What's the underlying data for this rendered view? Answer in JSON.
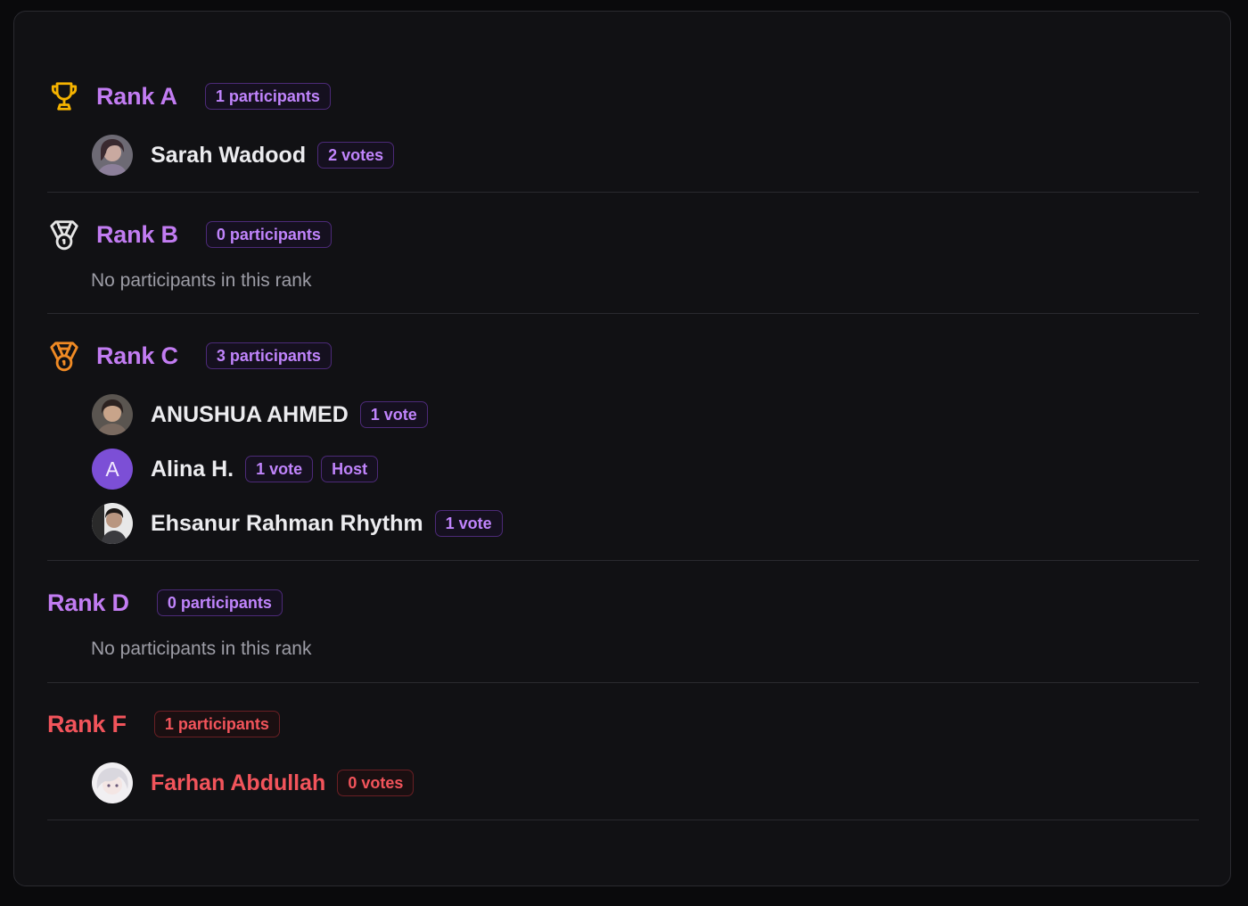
{
  "colors": {
    "rank_purple": "#c27cf2",
    "rank_red": "#f2545b",
    "trophy_gold": "#f5b300",
    "medal_silver": "#e5e5e5",
    "medal_bronze": "#f08a24",
    "host_avatar": "#7c4fd6"
  },
  "ranks": [
    {
      "title": "Rank A",
      "icon": "trophy-icon",
      "count_label": "1 participants",
      "participants": [
        {
          "name": "Sarah Wadood",
          "votes_label": "2 votes",
          "avatar": "photo"
        }
      ]
    },
    {
      "title": "Rank B",
      "icon": "medal-silver-icon",
      "count_label": "0 participants",
      "empty_label": "No participants in this rank",
      "participants": []
    },
    {
      "title": "Rank C",
      "icon": "medal-bronze-icon",
      "count_label": "3 participants",
      "participants": [
        {
          "name": "ANUSHUA AHMED",
          "votes_label": "1 vote",
          "avatar": "photo"
        },
        {
          "name": "Alina H.",
          "votes_label": "1 vote",
          "host_label": "Host",
          "avatar_initial": "A"
        },
        {
          "name": "Ehsanur Rahman Rhythm",
          "votes_label": "1 vote",
          "avatar": "photo"
        }
      ]
    },
    {
      "title": "Rank D",
      "count_label": "0 participants",
      "empty_label": "No participants in this rank",
      "participants": []
    },
    {
      "title": "Rank F",
      "count_label": "1 participants",
      "participants": [
        {
          "name": "Farhan Abdullah",
          "votes_label": "0 votes",
          "avatar": "photo"
        }
      ]
    }
  ]
}
